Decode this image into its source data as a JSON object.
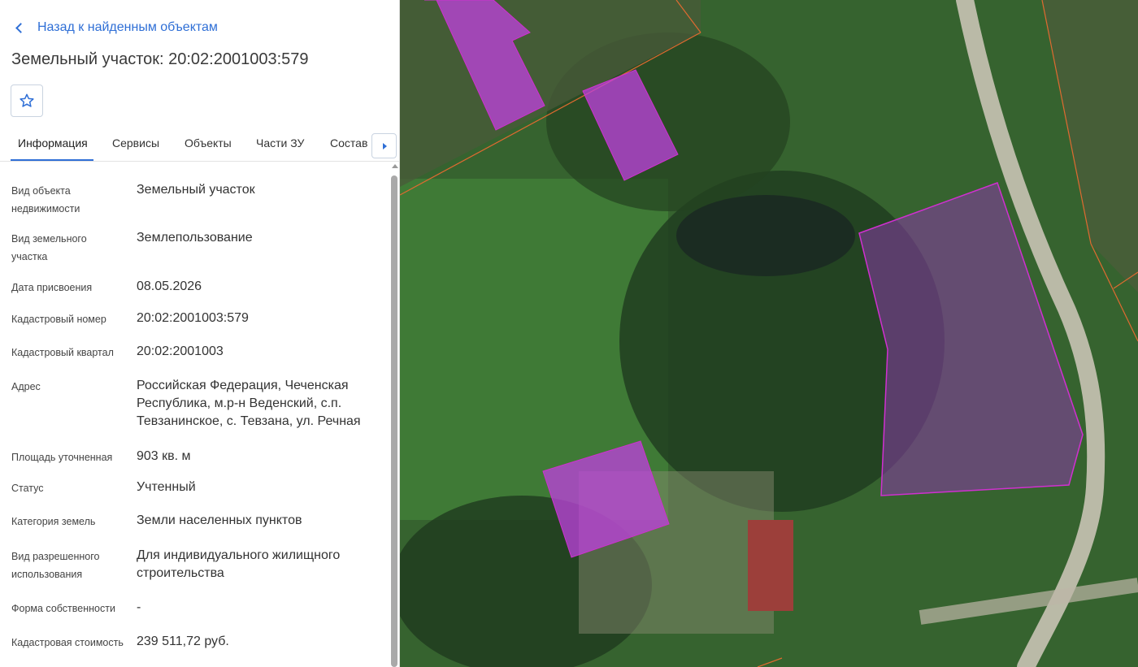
{
  "back_link": "Назад к найденным объектам",
  "title": "Земельный участок: 20:02:2001003:579",
  "favorite_icon": "star-outline-icon",
  "tabs": [
    "Информация",
    "Сервисы",
    "Объекты",
    "Части ЗУ",
    "Состав"
  ],
  "active_tab": "Информация",
  "info": {
    "object_type": {
      "label": "Вид объекта недвижимости",
      "value": "Земельный участок"
    },
    "land_type": {
      "label": "Вид земельного участка",
      "value": "Землепользование"
    },
    "assign_date": {
      "label": "Дата присвоения",
      "value": "08.05.2026"
    },
    "cadastral_number": {
      "label": "Кадастровый номер",
      "value": "20:02:2001003:579"
    },
    "cadastral_block": {
      "label": "Кадастровый квартал",
      "value": "20:02:2001003"
    },
    "address": {
      "label": "Адрес",
      "value": "Российская Федерация, Чеченская Республика, м.р-н Веденский, с.п. Тевзанинское, с. Тевзана, ул. Речная"
    },
    "area": {
      "label": "Площадь уточненная",
      "value": "903 кв. м"
    },
    "status": {
      "label": "Статус",
      "value": "Учтенный"
    },
    "land_category": {
      "label": "Категория земель",
      "value": "Земли населенных пунктов"
    },
    "permitted_use": {
      "label": "Вид разрешенного использования",
      "value": "Для индивидуального жилищного строительства"
    },
    "ownership": {
      "label": "Форма собственности",
      "value": "-"
    },
    "cadastral_value": {
      "label": "Кадастровая стоимость",
      "value": "239 511,72 руб."
    }
  },
  "colors": {
    "accent": "#2f6fd6",
    "parcel_fill": "#c040e0",
    "parcel_stroke": "#d030d0",
    "boundary_line": "#e06a30",
    "vegetation": "#2f5a2f"
  }
}
